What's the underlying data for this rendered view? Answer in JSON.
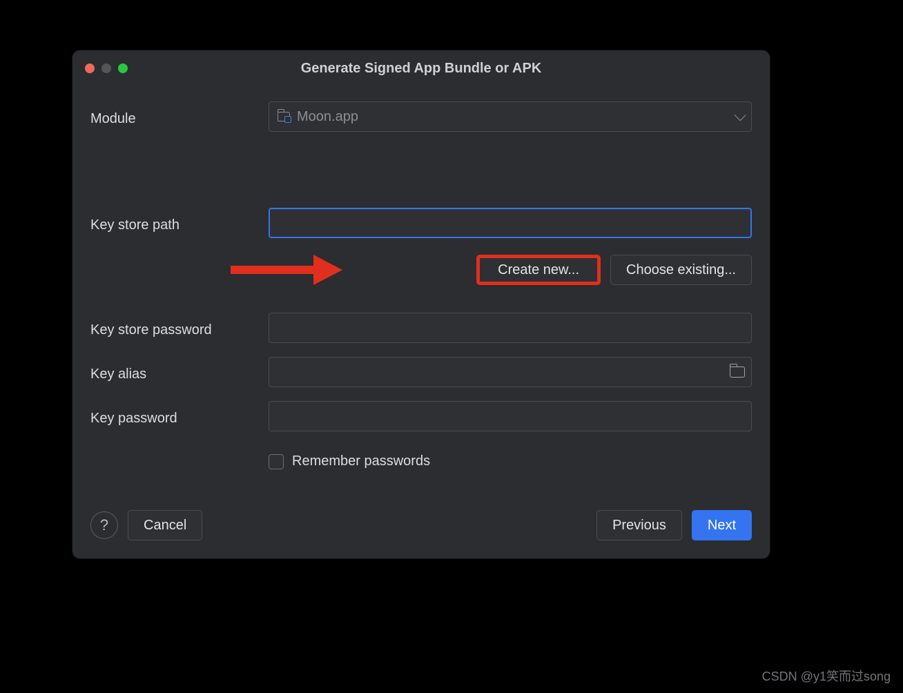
{
  "dialog": {
    "title": "Generate Signed App Bundle or APK"
  },
  "labels": {
    "module": "Module",
    "key_store_path": "Key store path",
    "key_store_password": "Key store password",
    "key_alias": "Key alias",
    "key_password": "Key password",
    "remember_passwords": "Remember passwords"
  },
  "module": {
    "selected": "Moon.app"
  },
  "buttons": {
    "create_new": "Create new...",
    "choose_existing": "Choose existing...",
    "help": "?",
    "cancel": "Cancel",
    "previous": "Previous",
    "next": "Next"
  },
  "values": {
    "key_store_path": "",
    "key_store_password": "",
    "key_alias": "",
    "key_password": ""
  },
  "watermark": "CSDN @y1笑而过song"
}
